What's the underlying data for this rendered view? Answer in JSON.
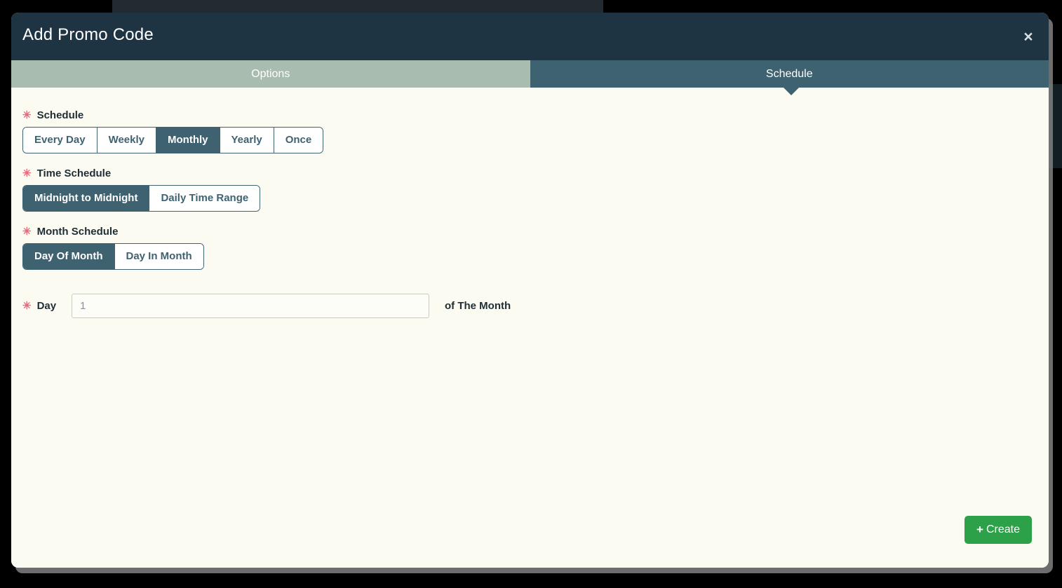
{
  "modal": {
    "title": "Add Promo Code",
    "close_icon": "close-icon",
    "close_label": "×"
  },
  "tabs": [
    {
      "label": "Options",
      "active": false
    },
    {
      "label": "Schedule",
      "active": true
    }
  ],
  "form": {
    "required_marker": "✳",
    "schedule": {
      "label": "Schedule",
      "options": [
        {
          "label": "Every Day",
          "selected": false
        },
        {
          "label": "Weekly",
          "selected": false
        },
        {
          "label": "Monthly",
          "selected": true
        },
        {
          "label": "Yearly",
          "selected": false
        },
        {
          "label": "Once",
          "selected": false
        }
      ]
    },
    "time_schedule": {
      "label": "Time Schedule",
      "options": [
        {
          "label": "Midnight to Midnight",
          "selected": true
        },
        {
          "label": "Daily Time Range",
          "selected": false
        }
      ]
    },
    "month_schedule": {
      "label": "Month Schedule",
      "options": [
        {
          "label": "Day Of Month",
          "selected": true
        },
        {
          "label": "Day In Month",
          "selected": false
        }
      ]
    },
    "day": {
      "label": "Day",
      "placeholder": "1",
      "value": "",
      "suffix": "of The Month"
    }
  },
  "footer": {
    "create_label": "Create",
    "create_plus": "+"
  },
  "colors": {
    "header_bg": "#1e3442",
    "tab_active": "#3f6271",
    "tab_inactive": "#a8bdaf",
    "body_bg": "#fbfbf2",
    "accent_slate": "#3f6271",
    "required_star": "#e8697d",
    "create_green": "#2ca14a"
  }
}
